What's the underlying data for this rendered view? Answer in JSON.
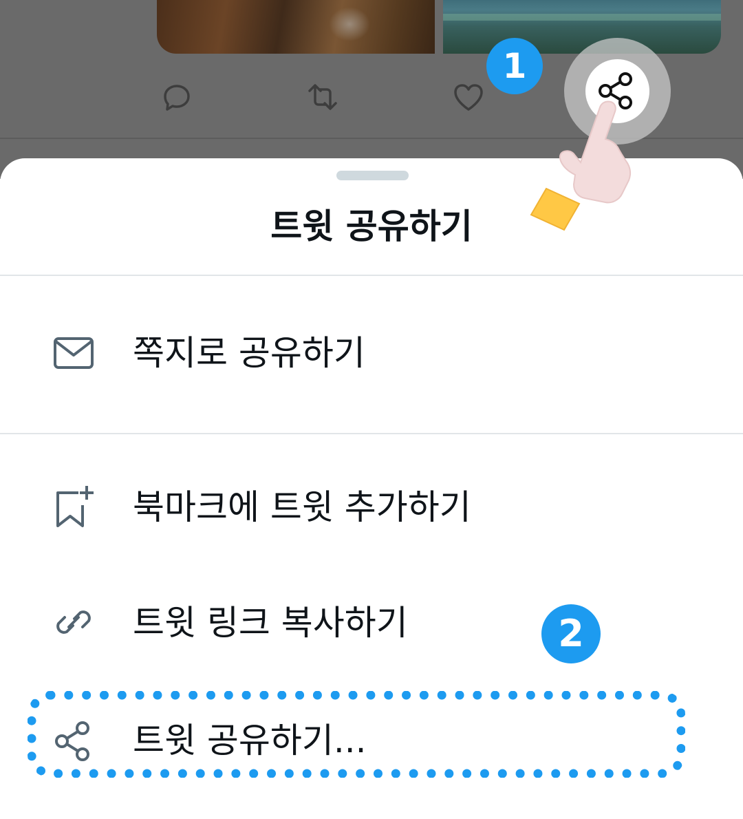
{
  "sheet": {
    "title": "트윗 공유하기",
    "items": [
      {
        "icon": "envelope-icon",
        "label": "쪽지로 공유하기"
      },
      {
        "icon": "bookmark-add-icon",
        "label": "북마크에 트윗 추가하기"
      },
      {
        "icon": "link-icon",
        "label": "트윗 링크 복사하기"
      },
      {
        "icon": "share-icon",
        "label": "트윗 공유하기..."
      }
    ]
  },
  "tweet": {
    "actions": [
      "reply-icon",
      "retweet-icon",
      "like-icon",
      "share-icon"
    ]
  },
  "annotations": {
    "step1": "1",
    "step2": "2"
  },
  "colors": {
    "accent": "#1d9bf0",
    "overlay": "#6a6a6a",
    "icon": "#536471",
    "text": "#0f1419"
  }
}
